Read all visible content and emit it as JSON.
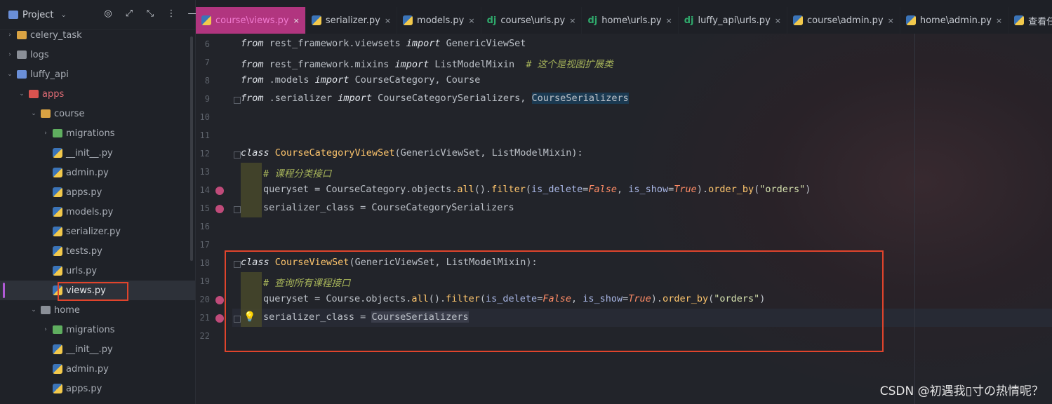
{
  "project_panel": {
    "title": "Project",
    "tools": [
      "◎",
      "⤢",
      "⤡",
      "⋮",
      "—"
    ],
    "tree": [
      {
        "label": "celery_task",
        "depth": 1,
        "type": "folder",
        "arrow": "›"
      },
      {
        "label": "logs",
        "depth": 1,
        "type": "folder-grey",
        "arrow": "›"
      },
      {
        "label": "luffy_api",
        "depth": 1,
        "type": "folder-blue",
        "arrow": "⌄"
      },
      {
        "label": "apps",
        "depth": 2,
        "type": "folder-red",
        "arrow": "⌄"
      },
      {
        "label": "course",
        "depth": 3,
        "type": "folder",
        "arrow": "⌄"
      },
      {
        "label": "migrations",
        "depth": 4,
        "type": "folder-green",
        "arrow": "›"
      },
      {
        "label": "__init__.py",
        "depth": 4,
        "type": "py",
        "arrow": ""
      },
      {
        "label": "admin.py",
        "depth": 4,
        "type": "py",
        "arrow": ""
      },
      {
        "label": "apps.py",
        "depth": 4,
        "type": "py",
        "arrow": ""
      },
      {
        "label": "models.py",
        "depth": 4,
        "type": "py",
        "arrow": ""
      },
      {
        "label": "serializer.py",
        "depth": 4,
        "type": "py",
        "arrow": ""
      },
      {
        "label": "tests.py",
        "depth": 4,
        "type": "py",
        "arrow": ""
      },
      {
        "label": "urls.py",
        "depth": 4,
        "type": "py",
        "arrow": ""
      },
      {
        "label": "views.py",
        "depth": 4,
        "type": "py",
        "arrow": "",
        "selected": true
      },
      {
        "label": "home",
        "depth": 3,
        "type": "folder-grey",
        "arrow": "⌄"
      },
      {
        "label": "migrations",
        "depth": 4,
        "type": "folder-green",
        "arrow": "›"
      },
      {
        "label": "__init__.py",
        "depth": 4,
        "type": "py",
        "arrow": ""
      },
      {
        "label": "admin.py",
        "depth": 4,
        "type": "py",
        "arrow": ""
      },
      {
        "label": "apps.py",
        "depth": 4,
        "type": "py",
        "arrow": ""
      }
    ]
  },
  "tabs": [
    {
      "label": "course\\views.py",
      "icon": "py",
      "active": true
    },
    {
      "label": "serializer.py",
      "icon": "py"
    },
    {
      "label": "models.py",
      "icon": "py"
    },
    {
      "label": "course\\urls.py",
      "icon": "dj"
    },
    {
      "label": "home\\urls.py",
      "icon": "dj"
    },
    {
      "label": "luffy_api\\urls.py",
      "icon": "dj"
    },
    {
      "label": "course\\admin.py",
      "icon": "py"
    },
    {
      "label": "home\\admin.py",
      "icon": "py"
    },
    {
      "label": "查看任务结果.py",
      "icon": "py"
    }
  ],
  "tab_close": "×",
  "tab_dj": "dj",
  "bulb_icon": "💡",
  "code": {
    "line_numbers": [
      "6",
      "7",
      "8",
      "9",
      "10",
      "11",
      "12",
      "13",
      "14",
      "15",
      "16",
      "17",
      "18",
      "19",
      "20",
      "21",
      "22"
    ],
    "l6": {
      "kw1": "from",
      "mod": " rest_framework.viewsets ",
      "kw2": "import",
      "name": " GenericViewSet"
    },
    "l7": {
      "kw1": "from",
      "mod": " rest_framework.mixins ",
      "kw2": "import",
      "name": " ListModelMixin  ",
      "comment": "# 这个是视图扩展类"
    },
    "l8": {
      "kw1": "from",
      "mod": " .models ",
      "kw2": "import",
      "name": " CourseCategory, Course"
    },
    "l9": {
      "kw1": "from",
      "mod": " .serializer ",
      "kw2": "import",
      "name": " CourseCategorySerializers, ",
      "hl": "CourseSerializers"
    },
    "l12": {
      "kw": "class",
      "cls": " CourseCategoryViewSet",
      "bases": "(GenericViewSet, ListModelMixin):"
    },
    "l13": {
      "comment": "# 课程分类接口"
    },
    "l14": {
      "a": "queryset = CourseCategory.objects.",
      "f1": "all",
      "b": "().",
      "f2": "filter",
      "c": "(",
      "p1": "is_delete",
      "d": "=",
      "v1": "False",
      "e": ", ",
      "p2": "is_show",
      "g": "=",
      "v2": "True",
      "h": ").",
      "f3": "order_by",
      "i": "(",
      "s": "\"orders\"",
      "j": ")"
    },
    "l15": {
      "text": "serializer_class = CourseCategorySerializers"
    },
    "l18": {
      "kw": "class",
      "cls": " CourseViewSet",
      "bases": "(GenericViewSet, ListModelMixin):"
    },
    "l19": {
      "comment": "# 查询所有课程接口"
    },
    "l20": {
      "a": "queryset = Course.objects.",
      "f1": "all",
      "b": "().",
      "f2": "filter",
      "c": "(",
      "p1": "is_delete",
      "d": "=",
      "v1": "False",
      "e": ", ",
      "p2": "is_show",
      "g": "=",
      "v2": "True",
      "h": ").",
      "f3": "order_by",
      "i": "(",
      "s": "\"orders\"",
      "j": ")"
    },
    "l21": {
      "a": "serializer_class = ",
      "hl": "CourseSerializers"
    }
  },
  "watermark": "CSDN @初遇我▯寸の热情呢？",
  "colors": {
    "active_tab": "#b1357f",
    "highlight_box": "#e0442c"
  }
}
